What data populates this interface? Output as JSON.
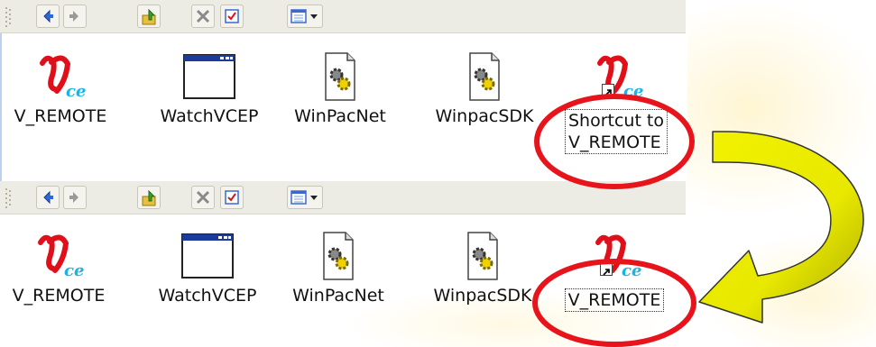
{
  "panels": [
    {
      "items": [
        {
          "label": "V_REMOTE",
          "icon": "vce-logo-icon"
        },
        {
          "label": "WatchVCEP",
          "icon": "window-app-icon"
        },
        {
          "label": "WinPacNet",
          "icon": "gear-document-icon"
        },
        {
          "label": "WinpacSDK",
          "icon": "gear-document-icon"
        },
        {
          "label_line1": "Shortcut to",
          "label_line2": "V_REMOTE",
          "icon": "vce-shortcut-icon",
          "selected": true
        }
      ]
    },
    {
      "items": [
        {
          "label": "V_REMOTE",
          "icon": "vce-logo-icon"
        },
        {
          "label": "WatchVCEP",
          "icon": "window-app-icon"
        },
        {
          "label": "WinPacNet",
          "icon": "gear-document-icon"
        },
        {
          "label": "WinpacSDK",
          "icon": "gear-document-icon"
        },
        {
          "label": "V_REMOTE",
          "icon": "vce-shortcut-icon",
          "selected": true
        }
      ]
    }
  ],
  "toolbar_icons": [
    "back-icon",
    "forward-icon",
    "up-folder-icon",
    "delete-icon",
    "properties-icon",
    "views-icon"
  ],
  "colors": {
    "highlight_ellipse": "#e8141c",
    "curved_arrow_fill": "#f2f200",
    "curved_arrow_gradient_end": "#a8a800",
    "toolbar_bg": "#ecebe4",
    "vce_logo_red": "#e0101a",
    "vce_logo_blue": "#18b4e8"
  }
}
